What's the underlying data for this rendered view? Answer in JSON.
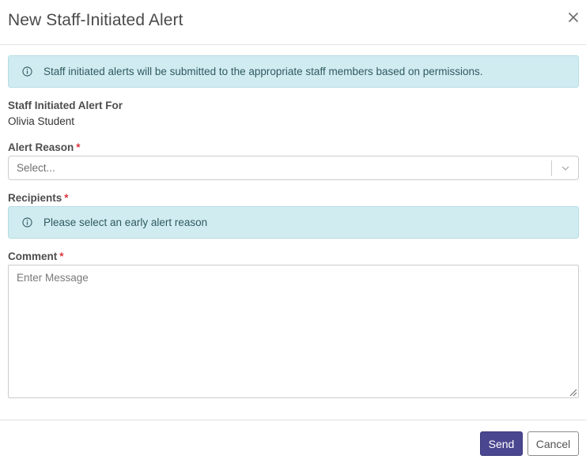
{
  "modal": {
    "title": "New Staff-Initiated Alert",
    "close_icon": "close-icon"
  },
  "info_banner": {
    "icon": "info-circle-icon",
    "text": "Staff initiated alerts will be submitted to the appropriate staff members based on permissions."
  },
  "alert_for": {
    "label": "Staff Initiated Alert For",
    "value": "Olivia Student"
  },
  "alert_reason": {
    "label": "Alert Reason",
    "required_marker": "*",
    "placeholder": "Select...",
    "icon": "chevron-down-icon"
  },
  "recipients": {
    "label": "Recipients",
    "required_marker": "*",
    "notice_icon": "info-circle-icon",
    "notice": "Please select an early alert reason"
  },
  "comment": {
    "label": "Comment",
    "required_marker": "*",
    "placeholder": "Enter Message",
    "value": ""
  },
  "footer": {
    "send_label": "Send",
    "cancel_label": "Cancel"
  },
  "colors": {
    "primary_button": "#4b4690",
    "info_background": "#d1ecf0",
    "required_marker": "#d9363e"
  }
}
